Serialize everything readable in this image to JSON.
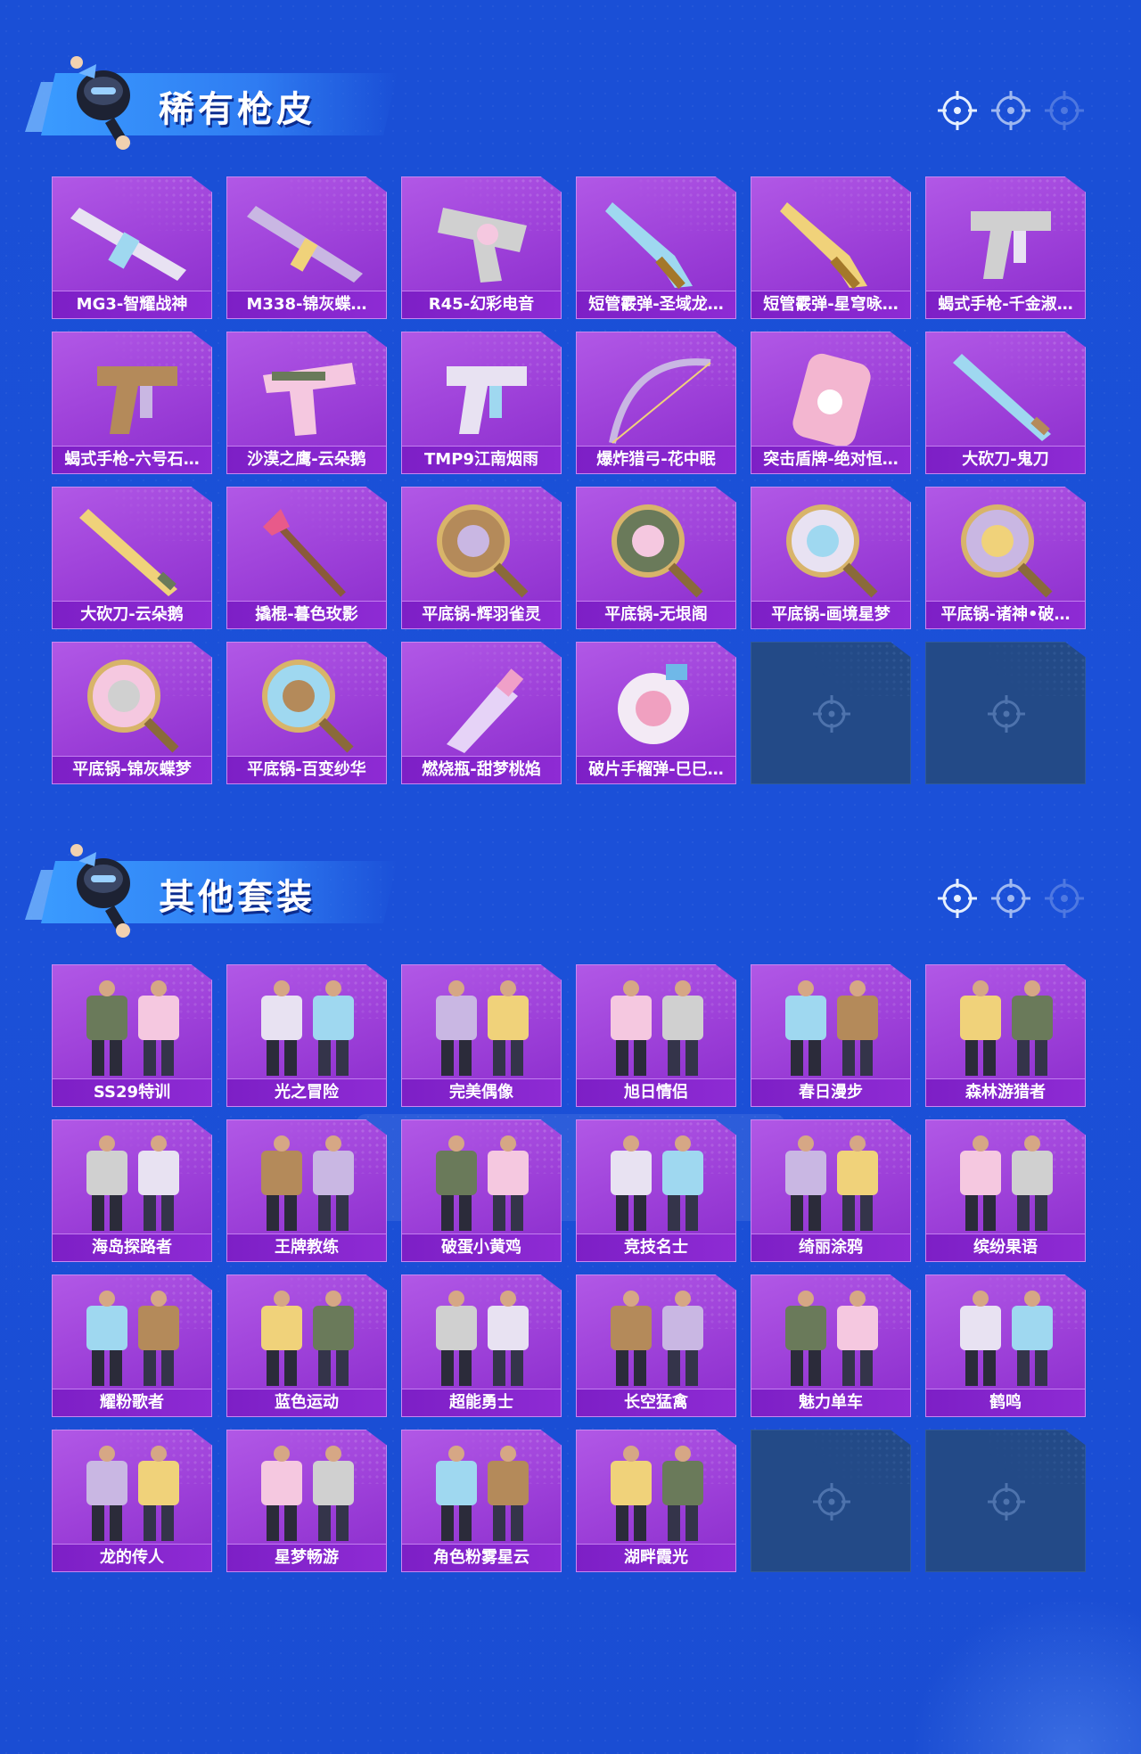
{
  "colors": {
    "background": "#1a4fd6",
    "card": "#9c3fd8",
    "label": "#7d1fc6",
    "empty_card": "#234a87",
    "title_shadow": "#0c2c8e"
  },
  "sections": [
    {
      "title": "稀有枪皮",
      "items": [
        {
          "label": "MG3-智耀战神",
          "icon": "machine-gun-icon"
        },
        {
          "label": "M338-锦灰蝶…",
          "icon": "rifle-icon"
        },
        {
          "label": "R45-幻彩电音",
          "icon": "revolver-icon"
        },
        {
          "label": "短管霰弹-圣域龙…",
          "icon": "sawed-off-shotgun-icon"
        },
        {
          "label": "短管霰弹-星穹咏…",
          "icon": "sawed-off-shotgun-icon"
        },
        {
          "label": "蝎式手枪-千金淑…",
          "icon": "smg-pistol-icon"
        },
        {
          "label": "蝎式手枪-六号石…",
          "icon": "smg-pistol-icon"
        },
        {
          "label": "沙漠之鹰-云朵鹅",
          "icon": "pistol-icon"
        },
        {
          "label": "TMP9江南烟雨",
          "icon": "smg-pistol-icon"
        },
        {
          "label": "爆炸猎弓-花中眠",
          "icon": "bow-icon"
        },
        {
          "label": "突击盾牌-绝对恒…",
          "icon": "shield-icon"
        },
        {
          "label": "大砍刀-鬼刀",
          "icon": "machete-icon"
        },
        {
          "label": "大砍刀-云朵鹅",
          "icon": "machete-icon"
        },
        {
          "label": "撬棍-暮色玫影",
          "icon": "crowbar-icon"
        },
        {
          "label": "平底锅-辉羽雀灵",
          "icon": "pan-icon"
        },
        {
          "label": "平底锅-无垠阁",
          "icon": "pan-icon"
        },
        {
          "label": "平底锅-画境星梦",
          "icon": "pan-icon"
        },
        {
          "label": "平底锅-诸神•破…",
          "icon": "pan-icon"
        },
        {
          "label": "平底锅-锦灰蝶梦",
          "icon": "pan-icon"
        },
        {
          "label": "平底锅-百变纱华",
          "icon": "pan-icon"
        },
        {
          "label": "燃烧瓶-甜梦桃焰",
          "icon": "molotov-icon"
        },
        {
          "label": "破片手榴弹-巳巳…",
          "icon": "grenade-icon"
        },
        {
          "label": "",
          "icon": "empty-slot"
        },
        {
          "label": "",
          "icon": "empty-slot"
        }
      ]
    },
    {
      "title": "其他套装",
      "items": [
        {
          "label": "SS29特训",
          "icon": "outfit-icon"
        },
        {
          "label": "光之冒险",
          "icon": "outfit-icon"
        },
        {
          "label": "完美偶像",
          "icon": "outfit-icon"
        },
        {
          "label": "旭日情侣",
          "icon": "outfit-icon"
        },
        {
          "label": "春日漫步",
          "icon": "outfit-icon"
        },
        {
          "label": "森林游猎者",
          "icon": "outfit-icon"
        },
        {
          "label": "海岛探路者",
          "icon": "outfit-icon"
        },
        {
          "label": "王牌教练",
          "icon": "outfit-icon"
        },
        {
          "label": "破蛋小黄鸡",
          "icon": "outfit-icon"
        },
        {
          "label": "竞技名士",
          "icon": "outfit-icon"
        },
        {
          "label": "绮丽涂鸦",
          "icon": "outfit-icon"
        },
        {
          "label": "缤纷果语",
          "icon": "outfit-icon"
        },
        {
          "label": "耀粉歌者",
          "icon": "outfit-icon"
        },
        {
          "label": "蓝色运动",
          "icon": "outfit-icon"
        },
        {
          "label": "超能勇士",
          "icon": "outfit-icon"
        },
        {
          "label": "长空猛禽",
          "icon": "outfit-icon"
        },
        {
          "label": "魅力单车",
          "icon": "outfit-icon"
        },
        {
          "label": "鹤鸣",
          "icon": "outfit-icon"
        },
        {
          "label": "龙的传人",
          "icon": "outfit-icon"
        },
        {
          "label": "星梦畅游",
          "icon": "outfit-icon"
        },
        {
          "label": "角色粉雾星云",
          "icon": "outfit-icon"
        },
        {
          "label": "湖畔霞光",
          "icon": "outfit-icon"
        },
        {
          "label": "",
          "icon": "empty-slot"
        },
        {
          "label": "",
          "icon": "empty-slot"
        }
      ]
    }
  ]
}
